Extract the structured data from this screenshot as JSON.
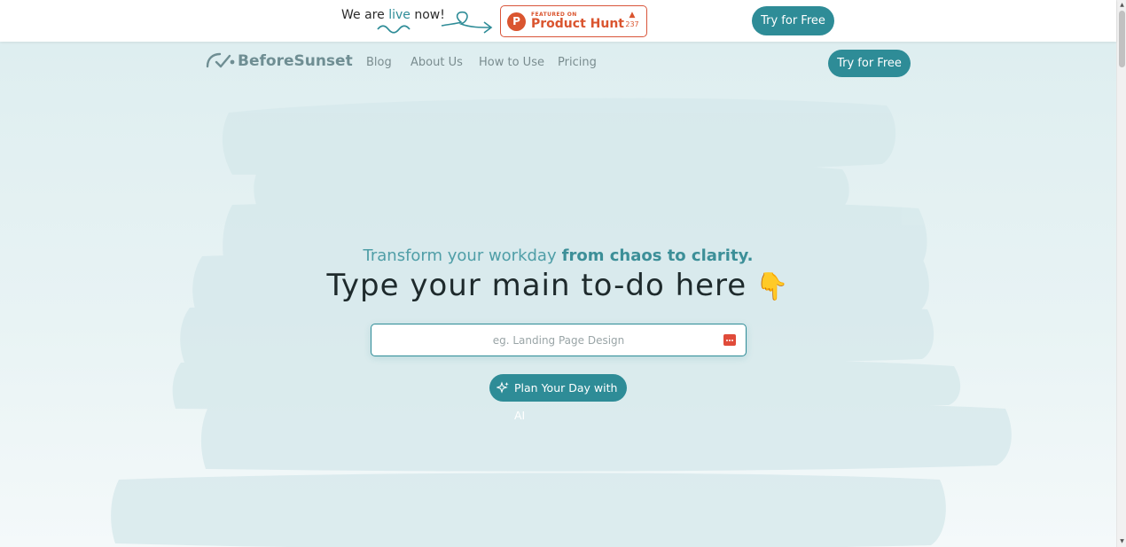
{
  "announcement": {
    "prefix": "We are ",
    "highlight": "live",
    "suffix": " now!",
    "product_hunt": {
      "featured_label": "FEATURED ON",
      "name": "Product Hunt",
      "logo_letter": "P",
      "upvote_glyph": "▲",
      "upvotes": "237"
    },
    "cta": "Try for Free"
  },
  "nav": {
    "brand": "BeforeSunset",
    "items": [
      {
        "label": "Blog"
      },
      {
        "label": "About Us"
      },
      {
        "label": "How to Use"
      },
      {
        "label": "Pricing"
      }
    ],
    "cta": "Try for Free"
  },
  "hero": {
    "tagline_light": "Transform your workday",
    "tagline_strong": "from chaos to clarity.",
    "headline": "Type your main to-do here",
    "headline_emoji": "👇",
    "input": {
      "value": "",
      "placeholder": "eg. Landing Page Design"
    },
    "cta": "Plan Your Day with AI"
  },
  "icons": {
    "logo": "sunset-check-logo-icon",
    "input": "keyboard-icon",
    "cta": "sparkle-icon"
  },
  "colors": {
    "accent": "#2e8c97",
    "product_hunt": "#da552f",
    "hero_bg": "#deeef0"
  }
}
